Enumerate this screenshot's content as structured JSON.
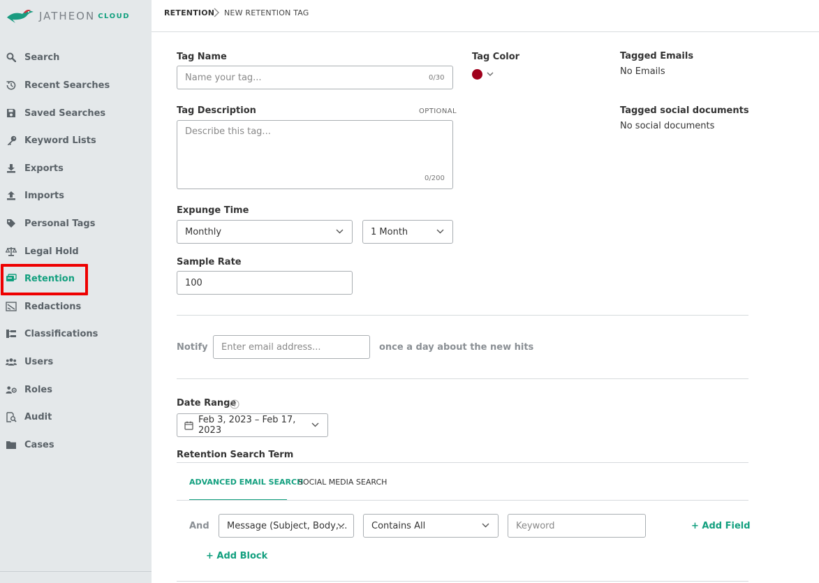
{
  "app": {
    "logo_text": "JATHEON",
    "logo_suffix": "CLOUD"
  },
  "sidebar": {
    "items": [
      {
        "label": "Search",
        "icon": "search-icon"
      },
      {
        "label": "Recent Searches",
        "icon": "history-icon"
      },
      {
        "label": "Saved Searches",
        "icon": "save-icon"
      },
      {
        "label": "Keyword Lists",
        "icon": "key-icon"
      },
      {
        "label": "Exports",
        "icon": "download-icon"
      },
      {
        "label": "Imports",
        "icon": "upload-icon"
      },
      {
        "label": "Personal Tags",
        "icon": "tag-icon"
      },
      {
        "label": "Legal Hold",
        "icon": "scale-icon"
      },
      {
        "label": "Retention",
        "icon": "retention-icon",
        "active": true
      },
      {
        "label": "Redactions",
        "icon": "redaction-icon"
      },
      {
        "label": "Classifications",
        "icon": "hierarchy-icon"
      },
      {
        "label": "Users",
        "icon": "users-icon"
      },
      {
        "label": "Roles",
        "icon": "roles-icon"
      },
      {
        "label": "Audit",
        "icon": "audit-icon"
      },
      {
        "label": "Cases",
        "icon": "folder-icon"
      }
    ]
  },
  "breadcrumb": {
    "root": "RETENTION",
    "current": "NEW RETENTION TAG"
  },
  "form": {
    "tag_name": {
      "label": "Tag Name",
      "placeholder": "Name your tag...",
      "counter": "0/30",
      "value": ""
    },
    "tag_color": {
      "label": "Tag Color",
      "color": "#a0001c"
    },
    "tag_description": {
      "label": "Tag Description",
      "optional": "OPTIONAL",
      "placeholder": "Describe this tag...",
      "counter": "0/200"
    },
    "expunge_time": {
      "label": "Expunge Time",
      "frequency": "Monthly",
      "period": "1 Month"
    },
    "sample_rate": {
      "label": "Sample Rate",
      "value": "100"
    },
    "notify": {
      "label": "Notify",
      "placeholder": "Enter email address...",
      "suffix": "once a day about the new hits"
    },
    "date_range": {
      "label": "Date Range",
      "value": "Feb 3, 2023 – Feb 17, 2023"
    },
    "search_term": {
      "label": "Retention Search Term",
      "tabs": [
        "ADVANCED EMAIL SEARCH",
        "SOCIAL MEDIA SEARCH"
      ],
      "operator": "And",
      "field": "Message (Subject, Body,...",
      "condition": "Contains All",
      "keyword_placeholder": "Keyword",
      "add_field": "+ Add Field",
      "add_block": "+ Add Block"
    }
  },
  "info": {
    "tagged_emails_label": "Tagged Emails",
    "tagged_emails_value": "No Emails",
    "tagged_social_label": "Tagged social documents",
    "tagged_social_value": "No social documents"
  },
  "colors": {
    "accent": "#13a07f",
    "highlight": "#ee0000",
    "sidebar_bg": "#e4e8ea"
  }
}
